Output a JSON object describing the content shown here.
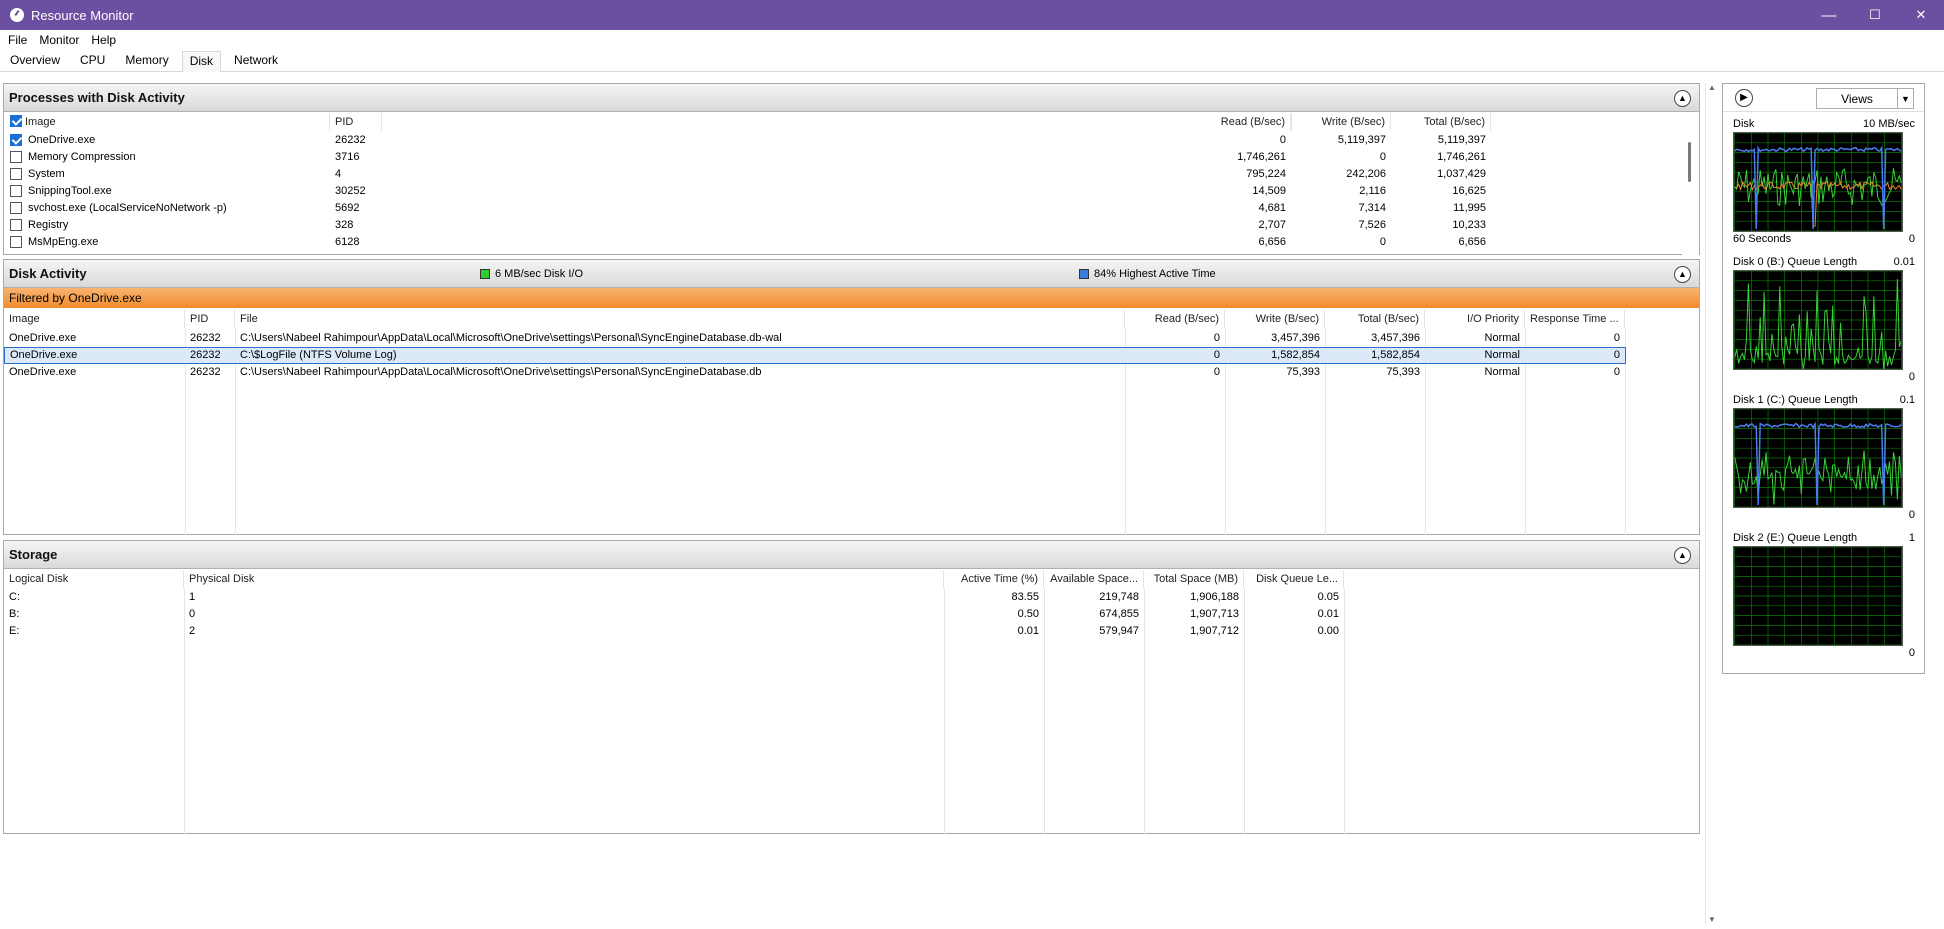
{
  "window": {
    "title": "Resource Monitor",
    "minimize": "—",
    "maximize": "☐",
    "close": "✕"
  },
  "menu": [
    "File",
    "Monitor",
    "Help"
  ],
  "tabs": [
    "Overview",
    "CPU",
    "Memory",
    "Disk",
    "Network"
  ],
  "active_tab": "Disk",
  "processes": {
    "title": "Processes with Disk Activity",
    "columns": [
      "Image",
      "PID",
      "Read (B/sec)",
      "Write (B/sec)",
      "Total (B/sec)"
    ],
    "rows": [
      {
        "image": "OneDrive.exe",
        "pid": "26232",
        "read": "0",
        "write": "5,119,397",
        "total": "5,119,397",
        "checked": true
      },
      {
        "image": "Memory Compression",
        "pid": "3716",
        "read": "1,746,261",
        "write": "0",
        "total": "1,746,261",
        "checked": false
      },
      {
        "image": "System",
        "pid": "4",
        "read": "795,224",
        "write": "242,206",
        "total": "1,037,429",
        "checked": false
      },
      {
        "image": "SnippingTool.exe",
        "pid": "30252",
        "read": "14,509",
        "write": "2,116",
        "total": "16,625",
        "checked": false
      },
      {
        "image": "svchost.exe (LocalServiceNoNetwork -p)",
        "pid": "5692",
        "read": "4,681",
        "write": "7,314",
        "total": "11,995",
        "checked": false
      },
      {
        "image": "Registry",
        "pid": "328",
        "read": "2,707",
        "write": "7,526",
        "total": "10,233",
        "checked": false
      },
      {
        "image": "MsMpEng.exe",
        "pid": "6128",
        "read": "6,656",
        "write": "0",
        "total": "6,656",
        "checked": false
      }
    ]
  },
  "disk_activity": {
    "title": "Disk Activity",
    "legend_io": "6 MB/sec Disk I/O",
    "legend_active": "84% Highest Active Time",
    "io_color": "#2ecc2e",
    "active_color": "#3a7be0",
    "filter": "Filtered by OneDrive.exe",
    "columns": [
      "Image",
      "PID",
      "File",
      "Read (B/sec)",
      "Write (B/sec)",
      "Total (B/sec)",
      "I/O Priority",
      "Response Time ..."
    ],
    "rows": [
      {
        "image": "OneDrive.exe",
        "pid": "26232",
        "file": "C:\\Users\\Nabeel Rahimpour\\AppData\\Local\\Microsoft\\OneDrive\\settings\\Personal\\SyncEngineDatabase.db-wal",
        "read": "0",
        "write": "3,457,396",
        "total": "3,457,396",
        "priority": "Normal",
        "response": "0"
      },
      {
        "image": "OneDrive.exe",
        "pid": "26232",
        "file": "C:\\$LogFile (NTFS Volume Log)",
        "read": "0",
        "write": "1,582,854",
        "total": "1,582,854",
        "priority": "Normal",
        "response": "0"
      },
      {
        "image": "OneDrive.exe",
        "pid": "26232",
        "file": "C:\\Users\\Nabeel Rahimpour\\AppData\\Local\\Microsoft\\OneDrive\\settings\\Personal\\SyncEngineDatabase.db",
        "read": "0",
        "write": "75,393",
        "total": "75,393",
        "priority": "Normal",
        "response": "0"
      }
    ]
  },
  "storage": {
    "title": "Storage",
    "columns": [
      "Logical Disk",
      "Physical Disk",
      "Active Time (%)",
      "Available Space...",
      "Total Space (MB)",
      "Disk Queue Le..."
    ],
    "rows": [
      {
        "logical": "C:",
        "physical": "1",
        "active": "83.55",
        "available": "219,748",
        "total": "1,906,188",
        "queue": "0.05"
      },
      {
        "logical": "B:",
        "physical": "0",
        "active": "0.50",
        "available": "674,855",
        "total": "1,907,713",
        "queue": "0.01"
      },
      {
        "logical": "E:",
        "physical": "2",
        "active": "0.01",
        "available": "579,947",
        "total": "1,907,712",
        "queue": "0.00"
      }
    ]
  },
  "side": {
    "views_label": "Views",
    "graphs": [
      {
        "label": "Disk",
        "max": "10 MB/sec",
        "footer_left": "60 Seconds",
        "footer_right": "0"
      },
      {
        "label": "Disk 0 (B:) Queue Length",
        "max": "0.01",
        "footer_left": "",
        "footer_right": "0"
      },
      {
        "label": "Disk 1 (C:) Queue Length",
        "max": "0.1",
        "footer_left": "",
        "footer_right": "0"
      },
      {
        "label": "Disk 2 (E:) Queue Length",
        "max": "1",
        "footer_left": "",
        "footer_right": "0"
      }
    ]
  }
}
